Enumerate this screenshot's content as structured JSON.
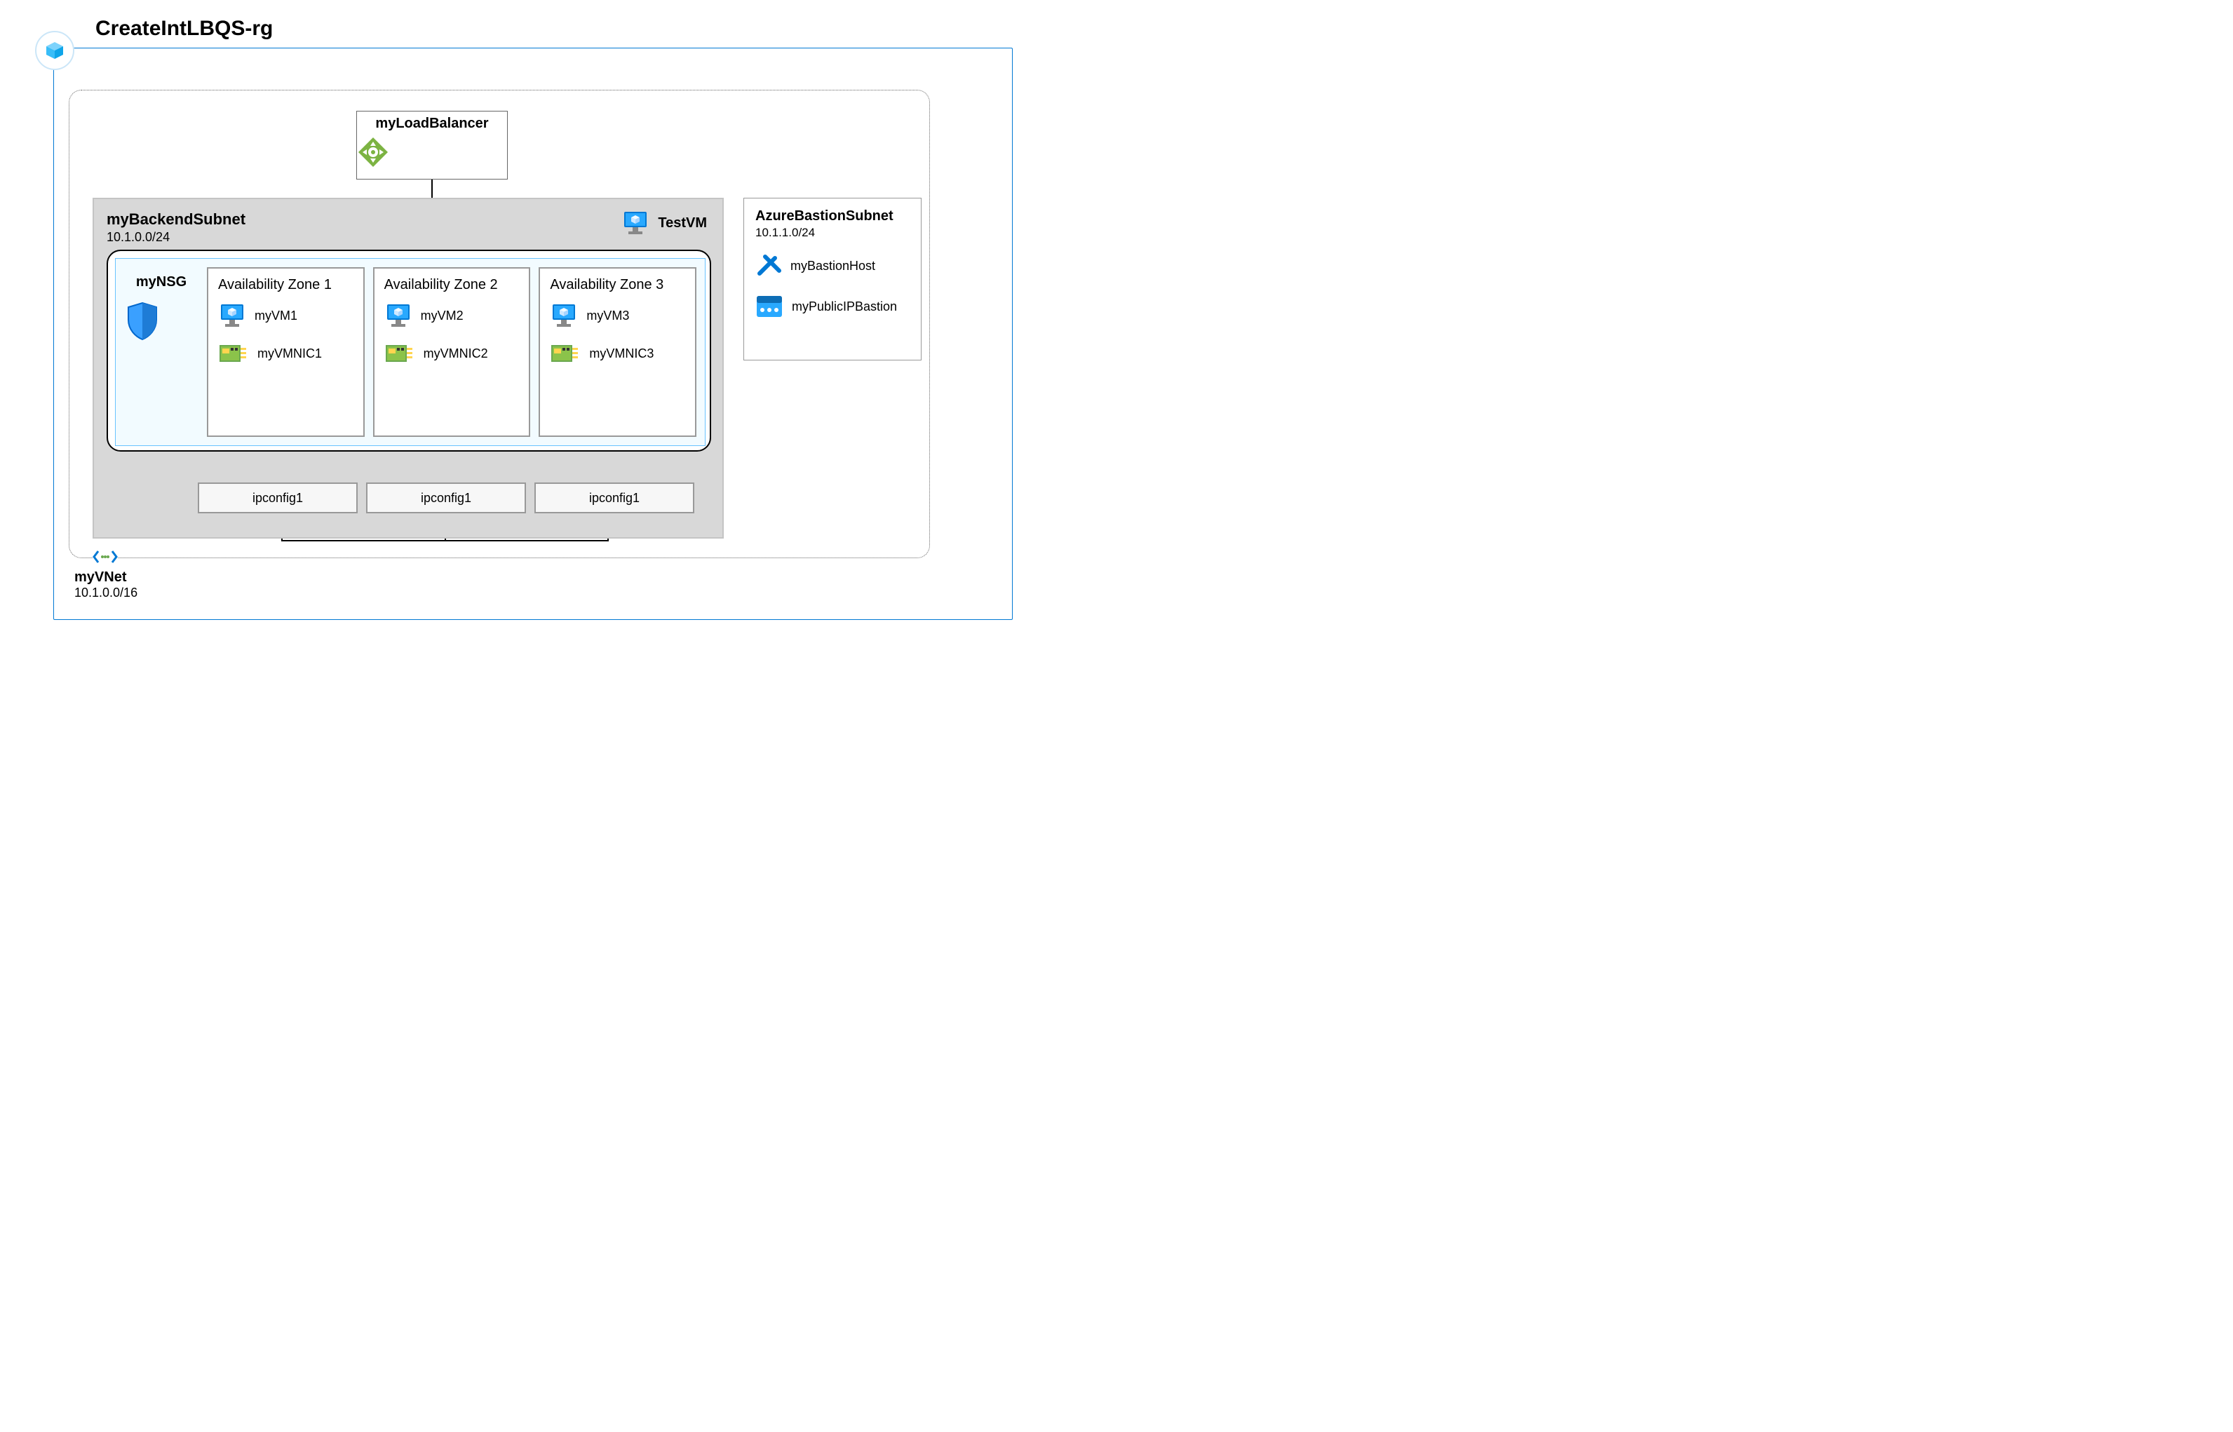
{
  "resourceGroup": {
    "name": "CreateIntLBQS-rg"
  },
  "vnet": {
    "name": "myVNet",
    "cidr": "10.1.0.0/16"
  },
  "loadBalancer": {
    "name": "myLoadBalancer"
  },
  "backendSubnet": {
    "name": "myBackendSubnet",
    "cidr": "10.1.0.0/24",
    "testVm": "TestVM",
    "nsg": {
      "name": "myNSG"
    },
    "zones": [
      {
        "title": "Availability Zone 1",
        "vm": "myVM1",
        "nic": "myVMNIC1",
        "ipconfig": "ipconfig1"
      },
      {
        "title": "Availability Zone 2",
        "vm": "myVM2",
        "nic": "myVMNIC2",
        "ipconfig": "ipconfig1"
      },
      {
        "title": "Availability Zone 3",
        "vm": "myVM3",
        "nic": "myVMNIC3",
        "ipconfig": "ipconfig1"
      }
    ]
  },
  "bastionSubnet": {
    "name": "AzureBastionSubnet",
    "cidr": "10.1.1.0/24",
    "host": "myBastionHost",
    "publicIp": "myPublicIPBastion"
  },
  "colors": {
    "azureBlue": "#0078d4",
    "lightBlue": "#69c3ff",
    "grayFill": "#d8d8d8"
  }
}
